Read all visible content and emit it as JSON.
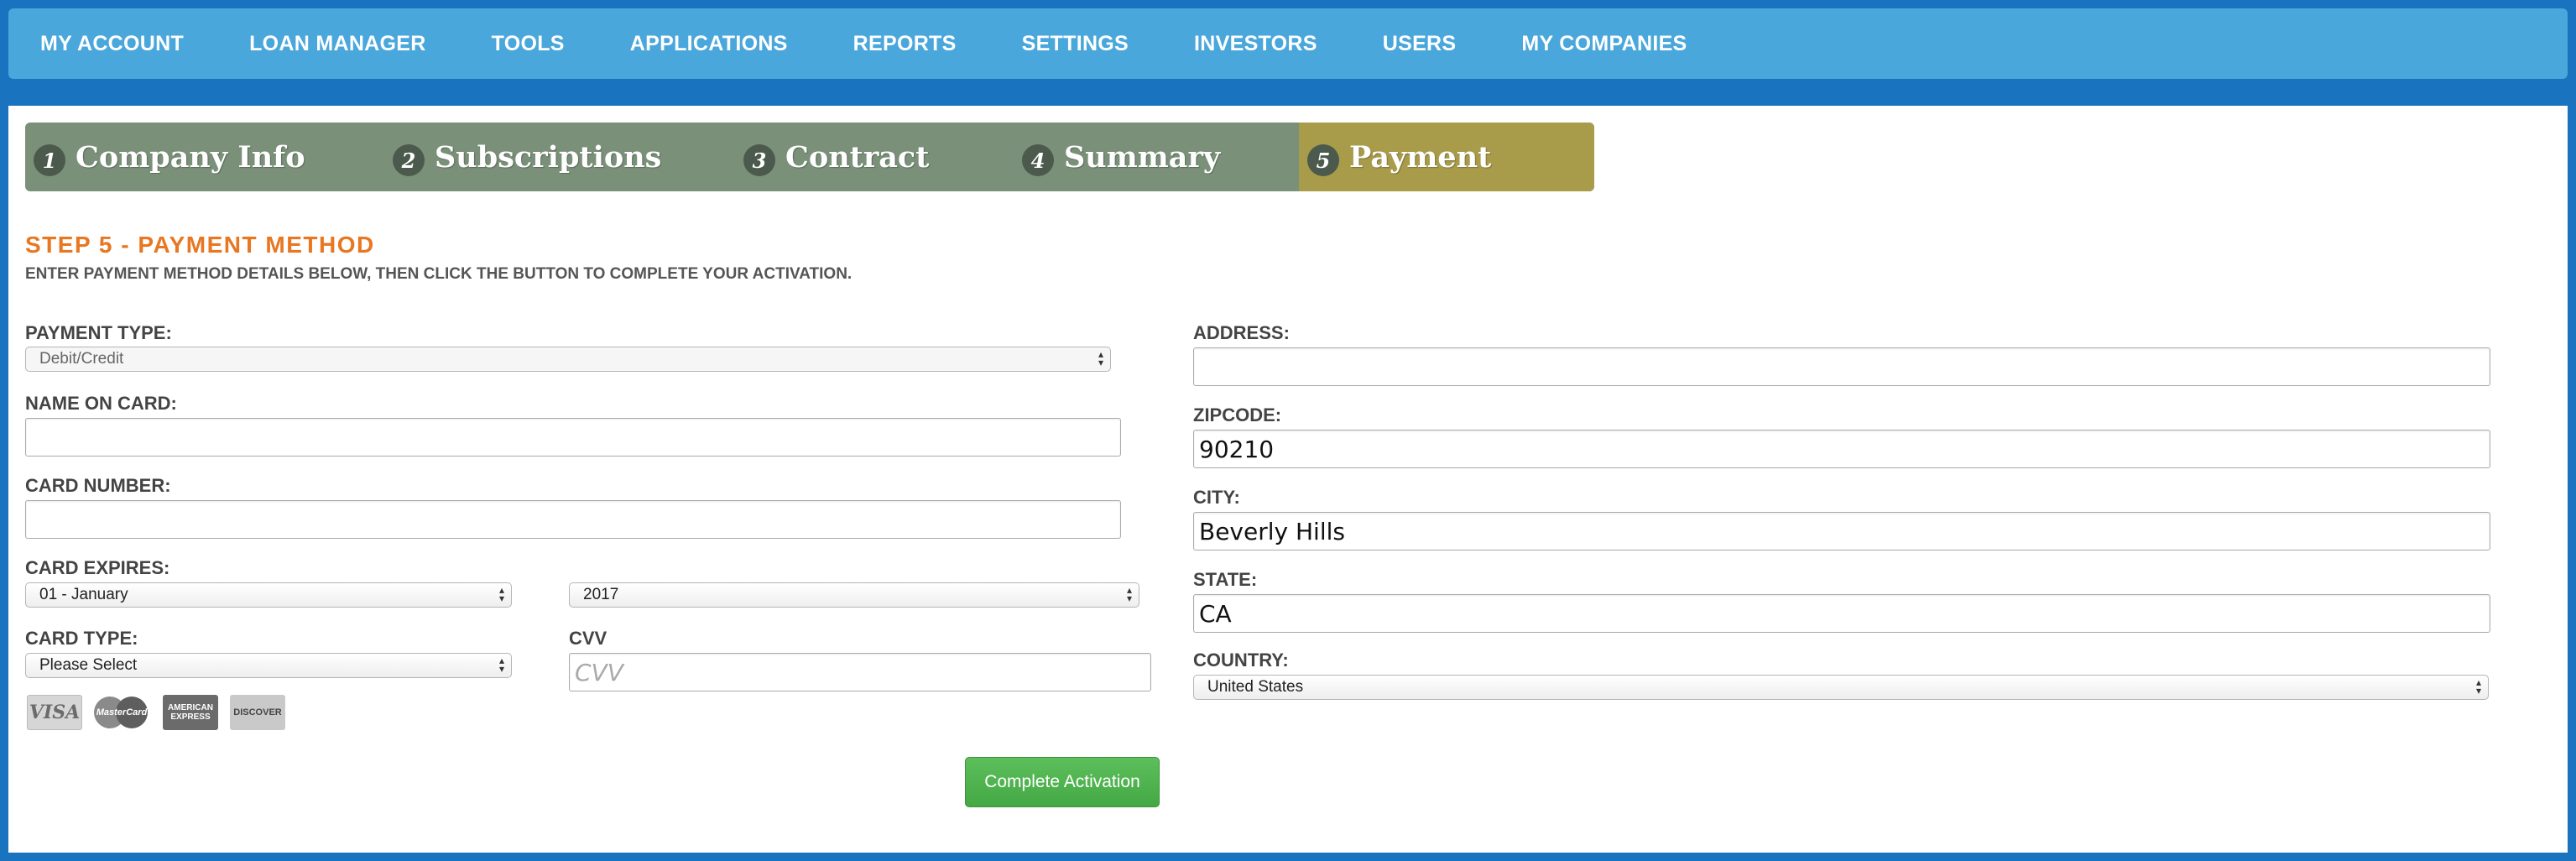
{
  "nav": {
    "items": [
      "MY ACCOUNT",
      "LOAN MANAGER",
      "TOOLS",
      "APPLICATIONS",
      "REPORTS",
      "SETTINGS",
      "INVESTORS",
      "USERS",
      "MY COMPANIES"
    ]
  },
  "steps": [
    {
      "num": "1",
      "label": "Company Info"
    },
    {
      "num": "2",
      "label": "Subscriptions"
    },
    {
      "num": "3",
      "label": "Contract"
    },
    {
      "num": "4",
      "label": "Summary"
    },
    {
      "num": "5",
      "label": "Payment"
    }
  ],
  "colors": {
    "accent_orange": "#e87722",
    "active_step": "#a89b4a",
    "step_bg": "#7a9079",
    "nav_bg": "#4aa7dc",
    "button_green": "#4cae4c"
  },
  "section": {
    "title": "STEP 5 - PAYMENT METHOD",
    "subtitle": "ENTER PAYMENT METHOD DETAILS BELOW, THEN CLICK THE BUTTON TO COMPLETE YOUR ACTIVATION."
  },
  "form": {
    "payment_type": {
      "label": "PAYMENT TYPE:",
      "value": "Debit/Credit"
    },
    "name_on_card": {
      "label": "NAME ON CARD:",
      "value": ""
    },
    "card_number": {
      "label": "CARD NUMBER:",
      "value": ""
    },
    "card_expires": {
      "label": "CARD EXPIRES:",
      "month": "01 - January",
      "year": "2017"
    },
    "card_type": {
      "label": "CARD TYPE:",
      "value": "Please Select"
    },
    "cvv": {
      "label": "CVV",
      "placeholder": "CVV",
      "value": ""
    },
    "address": {
      "label": "ADDRESS:",
      "value": ""
    },
    "zipcode": {
      "label": "ZIPCODE:",
      "value": "90210"
    },
    "city": {
      "label": "CITY:",
      "value": "Beverly Hills"
    },
    "state": {
      "label": "STATE:",
      "value": "CA"
    },
    "country": {
      "label": "COUNTRY:",
      "value": "United States"
    }
  },
  "card_icons": [
    {
      "name": "visa-icon",
      "text": "VISA"
    },
    {
      "name": "mastercard-icon",
      "text": "MasterCard"
    },
    {
      "name": "amex-icon",
      "text": "AMERICAN EXPRESS"
    },
    {
      "name": "discover-icon",
      "text": "DISCOVER"
    }
  ],
  "button": {
    "label": "Complete Activation"
  }
}
